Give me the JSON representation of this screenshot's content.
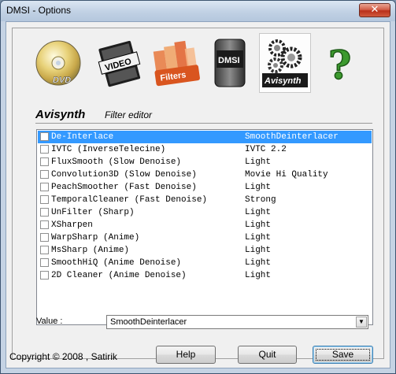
{
  "window": {
    "title": "DMSI - Options",
    "close_glyph": "✕"
  },
  "toolbar": {
    "icons": [
      {
        "name": "dvd",
        "label": "DVD"
      },
      {
        "name": "video",
        "label": "VIDEO"
      },
      {
        "name": "filters",
        "label": "Filters"
      },
      {
        "name": "dmsi",
        "label": "DMSI"
      },
      {
        "name": "avisynth",
        "label": "Avisynth"
      },
      {
        "name": "help",
        "label": "?"
      }
    ]
  },
  "section": {
    "title": "Avisynth",
    "subtitle": "Filter editor"
  },
  "filters": [
    {
      "name": "De-Interlace",
      "value": "SmoothDeinterlacer",
      "selected": true
    },
    {
      "name": "IVTC (InverseTelecine)",
      "value": "IVTC 2.2"
    },
    {
      "name": "FluxSmooth (Slow Denoise)",
      "value": "Light"
    },
    {
      "name": "Convolution3D (Slow Denoise)",
      "value": "Movie Hi Quality"
    },
    {
      "name": "PeachSmoother (Fast Denoise)",
      "value": "Light"
    },
    {
      "name": "TemporalCleaner (Fast Denoise)",
      "value": "Strong"
    },
    {
      "name": "UnFilter (Sharp)",
      "value": "Light"
    },
    {
      "name": "XSharpen",
      "value": "Light"
    },
    {
      "name": "WarpSharp (Anime)",
      "value": "Light"
    },
    {
      "name": "MsSharp (Anime)",
      "value": "Light"
    },
    {
      "name": "SmoothHiQ (Anime Denoise)",
      "value": "Light"
    },
    {
      "name": "2D Cleaner (Anime Denoise)",
      "value": "Light"
    }
  ],
  "value_field": {
    "label": "Value :",
    "selected": "SmoothDeinterlacer"
  },
  "footer": {
    "copyright": "Copyright © 2008 , Satirik",
    "help_label": "Help",
    "quit_label": "Quit",
    "save_label": "Save"
  },
  "colors": {
    "selection": "#3399ff",
    "title_bar": "#c1d1e4"
  }
}
